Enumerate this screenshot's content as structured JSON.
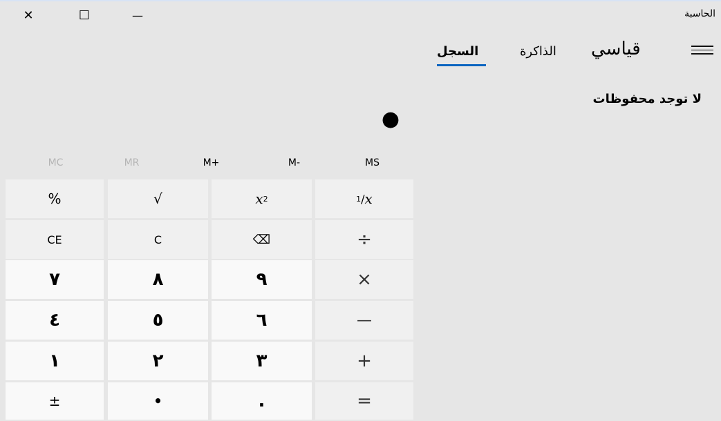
{
  "window": {
    "title": "الحاسبة",
    "close_glyph": "✕",
    "max_glyph": "☐",
    "min_glyph": "—"
  },
  "header": {
    "mode_title": "قياسي",
    "tabs": {
      "memory": "الذاكرة",
      "history": "السجل"
    },
    "active_tab": "history",
    "empty_message": "لا توجد محفوظات"
  },
  "display": {
    "value": "●"
  },
  "memory": {
    "mc": "MC",
    "mr": "MR",
    "m_plus": "M+",
    "m_minus": "M-",
    "ms": "MS"
  },
  "keys": {
    "percent": "%",
    "sqrt": "√",
    "square_base": "x",
    "square_exp": "2",
    "reciprocal_num": "1",
    "reciprocal_den": "x",
    "reciprocal_slash": "/",
    "ce": "CE",
    "c": "C",
    "backspace": "⌫",
    "divide": "÷",
    "d7": "٧",
    "d8": "٨",
    "d9": "٩",
    "multiply": "×",
    "d4": "٤",
    "d5": "٥",
    "d6": "٦",
    "minus": "—",
    "d1": "١",
    "d2": "٢",
    "d3": "٣",
    "plus": "+",
    "negate": "±",
    "d0": "•",
    "decimal": ".",
    "equals": "="
  },
  "colors": {
    "accent": "#0a64c0",
    "background": "#e6e6e6"
  }
}
